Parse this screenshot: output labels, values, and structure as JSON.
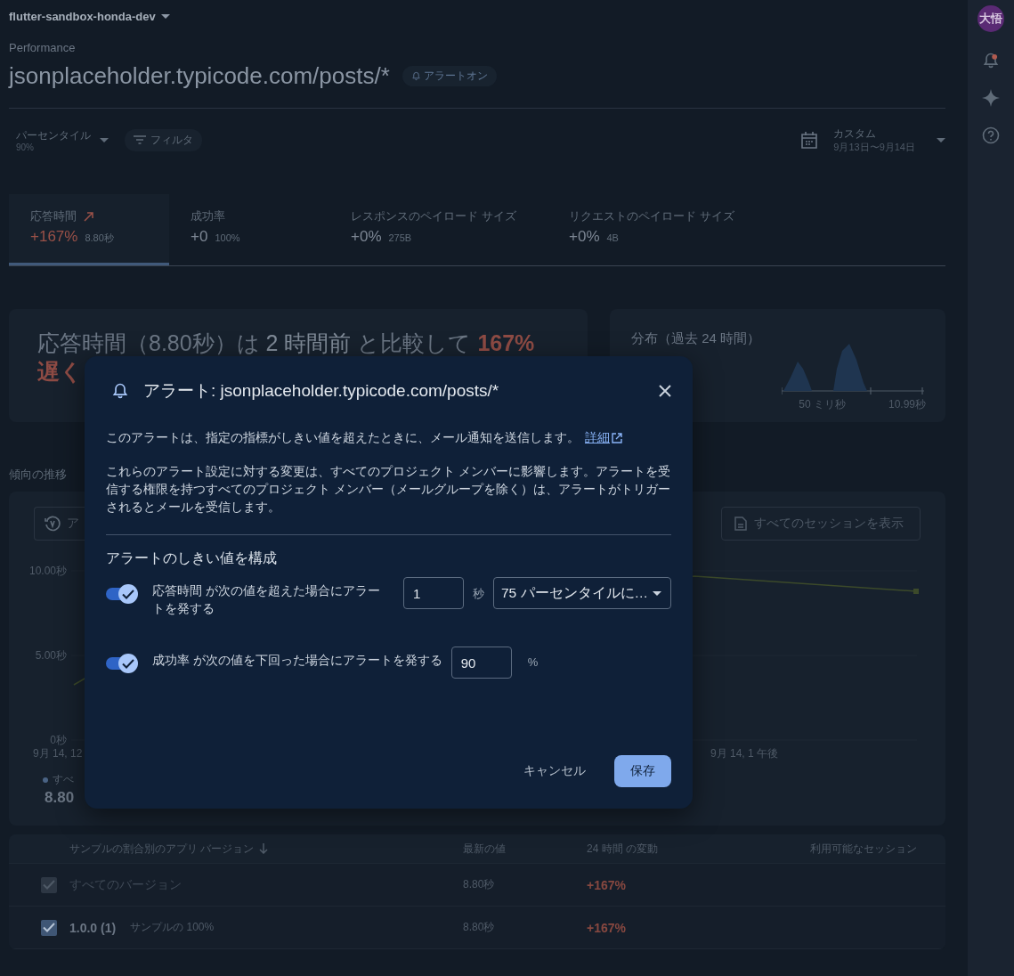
{
  "project": {
    "name": "flutter-sandbox-honda-dev"
  },
  "page": {
    "section": "Performance",
    "title": "jsonplaceholder.typicode.com/posts/*",
    "alert_chip": "アラートオン"
  },
  "filters": {
    "percentile": {
      "label": "パーセンタイル",
      "value": "90%"
    },
    "filter_chip": "フィルタ",
    "date": {
      "label": "カスタム",
      "value": "9月13日〜9月14日"
    }
  },
  "metric_tabs": [
    {
      "label": "応答時間",
      "change": "+167%",
      "value": "8.80秒",
      "rising": true,
      "selected": true
    },
    {
      "label": "成功率",
      "change": "+0",
      "value": "100%",
      "rising": false,
      "selected": false
    },
    {
      "label": "レスポンスのペイロード サイズ",
      "change": "+0%",
      "value": "275B",
      "rising": false,
      "selected": false
    },
    {
      "label": "リクエストのペイロード サイズ",
      "change": "+0%",
      "value": "4B",
      "rising": false,
      "selected": false
    }
  ],
  "summary": {
    "headline": [
      {
        "kind": "plain",
        "text": "応答時間（8.80秒）は "
      },
      {
        "kind": "strong",
        "text": "2 時間前"
      },
      {
        "kind": "plain",
        "text": " と比較して "
      },
      {
        "kind": "bad",
        "text": "167% 遅く"
      }
    ]
  },
  "distribution": {
    "title": "分布（過去 24 時間）",
    "min_label": "50 ミリ秒",
    "max_label": "10.99秒"
  },
  "trend_section": {
    "title": "傾向の推移",
    "compare_button": "ア",
    "sessions_button": "すべてのセッションを表示",
    "y_labels": [
      "10.00秒",
      "5.00秒",
      "0秒"
    ],
    "x_labels": [
      "9月 14, 12",
      "9月 14, 1 午後"
    ],
    "legend": {
      "label": "すべ",
      "value": "8.80"
    }
  },
  "table": {
    "columns": [
      {
        "label": "サンプルの割合別のアプリ バージョン",
        "sorted": true
      },
      {
        "label": "最新の値",
        "sorted": false
      },
      {
        "label": "24 時間 の変動",
        "sorted": false
      },
      {
        "label": "利用可能なセッション",
        "sorted": false
      }
    ],
    "rows": [
      {
        "checked": true,
        "disabled": true,
        "version": "すべてのバージョン",
        "latest": "8.80秒",
        "change": "+167%"
      },
      {
        "checked": true,
        "disabled": false,
        "version": "1.0.0 (1)",
        "sample": "サンプルの 100%",
        "latest": "8.80秒",
        "change": "+167%"
      }
    ]
  },
  "rail": {
    "avatar": "大悟"
  },
  "dialog": {
    "title": "アラート: jsonplaceholder.typicode.com/posts/*",
    "intro": "このアラートは、指定の指標がしきい値を超えたときに、メール通知を送信します。",
    "link": "詳細",
    "notice": "これらのアラート設定に対する変更は、すべてのプロジェクト メンバーに影響します。アラートを受信する権限を持つすべてのプロジェクト メンバー（メールグループを除く）は、アラートがトリガーされるとメールを受信します。",
    "section_title": "アラートのしきい値を構成",
    "rules": [
      {
        "enabled": true,
        "label": "応答時間 が次の値を超えた場合にアラートを発する",
        "value": "1",
        "unit": "秒",
        "percentile": "75 パーセンタイルに…"
      },
      {
        "enabled": true,
        "label": "成功率 が次の値を下回った場合にアラートを発する",
        "value": "90",
        "unit": "%"
      }
    ],
    "buttons": {
      "cancel": "キャンセル",
      "save": "保存"
    }
  }
}
